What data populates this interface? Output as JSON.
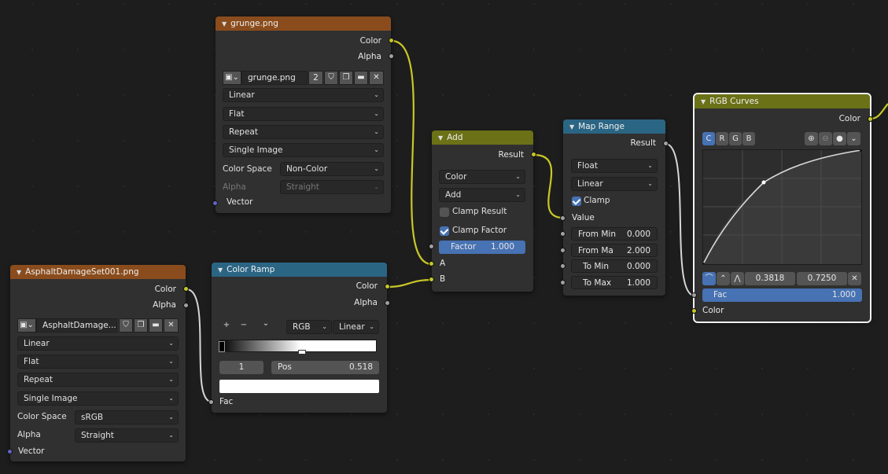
{
  "grunge": {
    "title": "grunge.png",
    "outputs": [
      "Color",
      "Alpha"
    ],
    "image_name": "grunge.png",
    "users": "2",
    "interpolation": "Linear",
    "projection": "Flat",
    "extension": "Repeat",
    "source": "Single Image",
    "color_space_label": "Color Space",
    "color_space": "Non-Color",
    "alpha_label": "Alpha",
    "alpha": "Straight",
    "input": "Vector"
  },
  "asphalt": {
    "title": "AsphaltDamageSet001.png",
    "outputs": [
      "Color",
      "Alpha"
    ],
    "image_name": "AsphaltDamage...",
    "interpolation": "Linear",
    "projection": "Flat",
    "extension": "Repeat",
    "source": "Single Image",
    "color_space_label": "Color Space",
    "color_space": "sRGB",
    "alpha_label": "Alpha",
    "alpha": "Straight",
    "input": "Vector"
  },
  "color_ramp": {
    "title": "Color Ramp",
    "outputs": [
      "Color",
      "Alpha"
    ],
    "add": "+",
    "remove": "−",
    "menu": "⌄",
    "color_mode": "RGB",
    "interpolation": "Linear",
    "stop_index": "1",
    "pos_label": "Pos",
    "pos_value": "0.518",
    "input": "Fac"
  },
  "add": {
    "title": "Add",
    "output": "Result",
    "data_type": "Color",
    "blend": "Add",
    "clamp_result": "Clamp Result",
    "clamp_factor": "Clamp Factor",
    "factor_label": "Factor",
    "factor_value": "1.000",
    "input_a": "A",
    "input_b": "B"
  },
  "map_range": {
    "title": "Map Range",
    "output": "Result",
    "data_type": "Float",
    "interpolation": "Linear",
    "clamp": "Clamp",
    "value_label": "Value",
    "fields": [
      {
        "label": "From Min",
        "value": "0.000"
      },
      {
        "label": "From Ma",
        "value": "2.000"
      },
      {
        "label": "To Min",
        "value": "0.000"
      },
      {
        "label": "To Max",
        "value": "1.000"
      }
    ]
  },
  "rgb_curves": {
    "title": "RGB Curves",
    "output": "Color",
    "channels": [
      "C",
      "R",
      "G",
      "B"
    ],
    "point_x": "0.3818",
    "point_y": "0.7250",
    "fac_label": "Fac",
    "fac_value": "1.000",
    "input": "Color"
  },
  "colors": {
    "texture_header": "#8a4c1c",
    "converter_header": "#2b6584",
    "math_header": "#6b7116",
    "link_color": "#c7c729",
    "link_float": "#a1a1a1",
    "accent": "#4772b3"
  }
}
